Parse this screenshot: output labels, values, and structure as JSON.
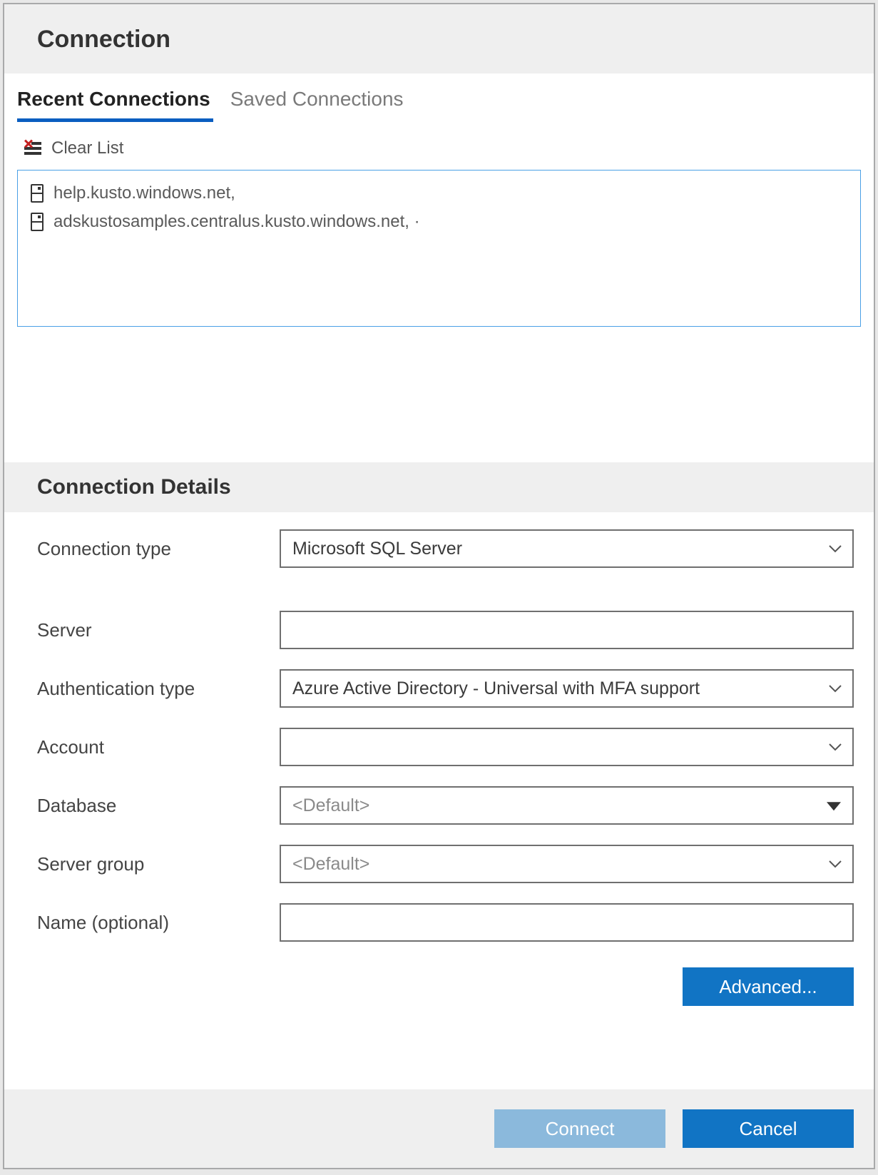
{
  "header": {
    "title": "Connection"
  },
  "tabs": {
    "recent": "Recent Connections",
    "saved": "Saved Connections",
    "active": "recent"
  },
  "clear_list": {
    "label": "Clear List"
  },
  "recent_connections": [
    {
      "label": "help.kusto.windows.net,"
    },
    {
      "label": "adskustosamples.centralus.kusto.windows.net,  ·"
    }
  ],
  "details": {
    "heading": "Connection Details",
    "fields": {
      "connection_type": {
        "label": "Connection type",
        "value": "Microsoft SQL Server"
      },
      "server": {
        "label": "Server",
        "value": ""
      },
      "auth_type": {
        "label": "Authentication type",
        "value": "Azure Active Directory - Universal with MFA support"
      },
      "account": {
        "label": "Account",
        "value": ""
      },
      "database": {
        "label": "Database",
        "value": "<Default>"
      },
      "server_group": {
        "label": "Server group",
        "value": "<Default>"
      },
      "name": {
        "label": "Name (optional)",
        "value": ""
      }
    },
    "advanced_label": "Advanced..."
  },
  "footer": {
    "connect": "Connect",
    "cancel": "Cancel"
  }
}
